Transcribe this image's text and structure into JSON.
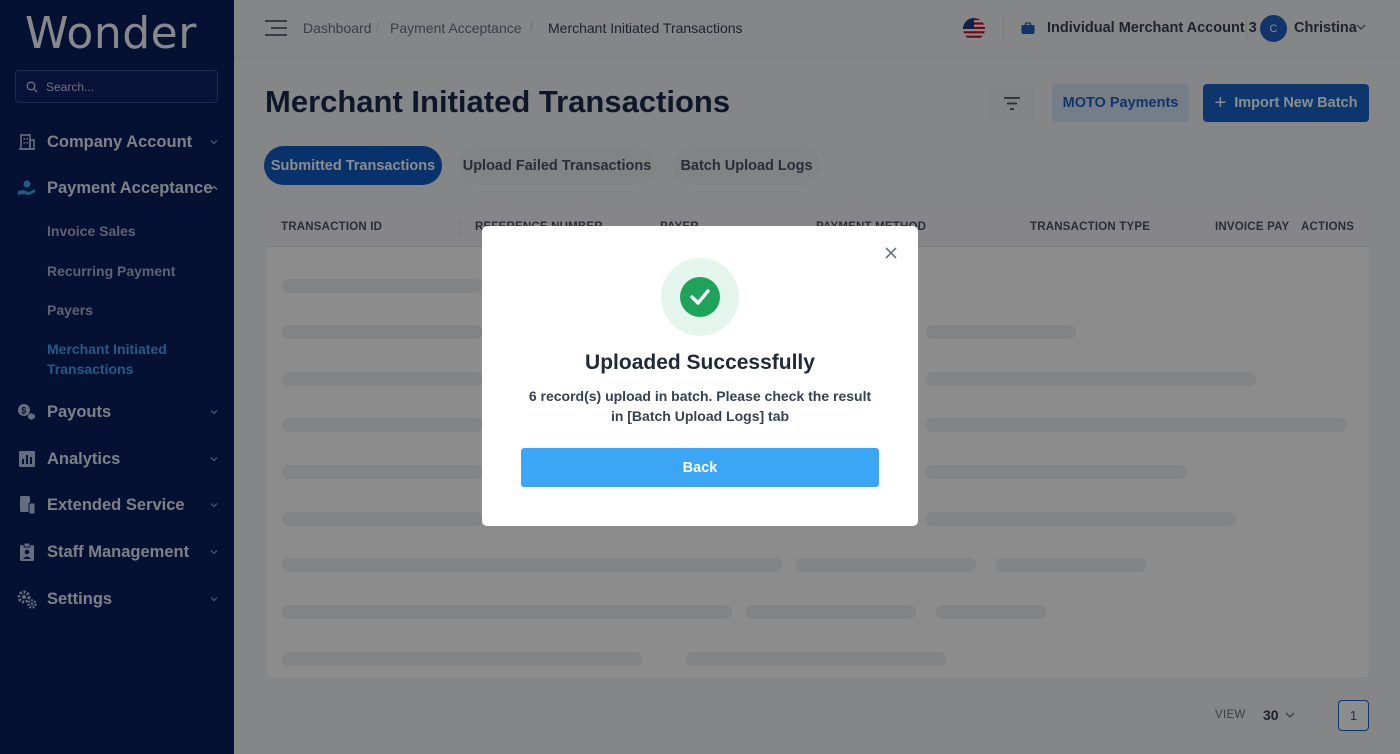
{
  "app": {
    "logo": "Wonder"
  },
  "search": {
    "placeholder": "Search..."
  },
  "sidebar": {
    "items": [
      {
        "label": "Company Account",
        "icon": "building-icon"
      },
      {
        "label": "Payment Acceptance",
        "icon": "hand-card-icon",
        "expanded": true,
        "children": [
          {
            "label": "Invoice Sales"
          },
          {
            "label": "Recurring Payment"
          },
          {
            "label": "Payers"
          },
          {
            "label": "Merchant Initiated Transactions",
            "label_line1": "Merchant Initiated",
            "label_line2": "Transactions",
            "active": true
          }
        ]
      },
      {
        "label": "Payouts",
        "icon": "coins-icon"
      },
      {
        "label": "Analytics",
        "icon": "bar-chart-icon"
      },
      {
        "label": "Extended Service",
        "icon": "devices-icon"
      },
      {
        "label": "Staff Management",
        "icon": "staff-icon"
      },
      {
        "label": "Settings",
        "icon": "gears-icon"
      }
    ]
  },
  "breadcrumb": [
    "Dashboard",
    "Payment Acceptance",
    "Merchant Initiated Transactions"
  ],
  "header": {
    "account_name": "Individual Merchant Account 3",
    "user_initial": "C",
    "user_name": "Christina"
  },
  "page": {
    "title": "Merchant Initiated Transactions",
    "moto_label": "MOTO Payments",
    "import_label": "Import New Batch"
  },
  "tabs": [
    {
      "label": "Submitted Transactions",
      "active": true
    },
    {
      "label": "Upload Failed Transactions"
    },
    {
      "label": "Batch Upload Logs"
    }
  ],
  "table": {
    "columns": [
      "TRANSACTION ID",
      "REFERENCE NUMBER",
      "PAYER",
      "PAYMENT METHOD",
      "TRANSACTION TYPE",
      "INVOICE PAY",
      "ACTIONS"
    ]
  },
  "pagination": {
    "view_label": "VIEW",
    "page_size": "30",
    "current_page": "1"
  },
  "modal": {
    "title": "Uploaded Successfully",
    "message": "6 record(s) upload in batch. Please check the result in [Batch Upload Logs] tab",
    "button_label": "Back"
  },
  "colors": {
    "sidebar_bg": "#0a1f5c",
    "primary": "#1763c6",
    "active_link": "#3fa6f5",
    "success": "#1fa35a",
    "modal_button": "#3aa6f5"
  }
}
